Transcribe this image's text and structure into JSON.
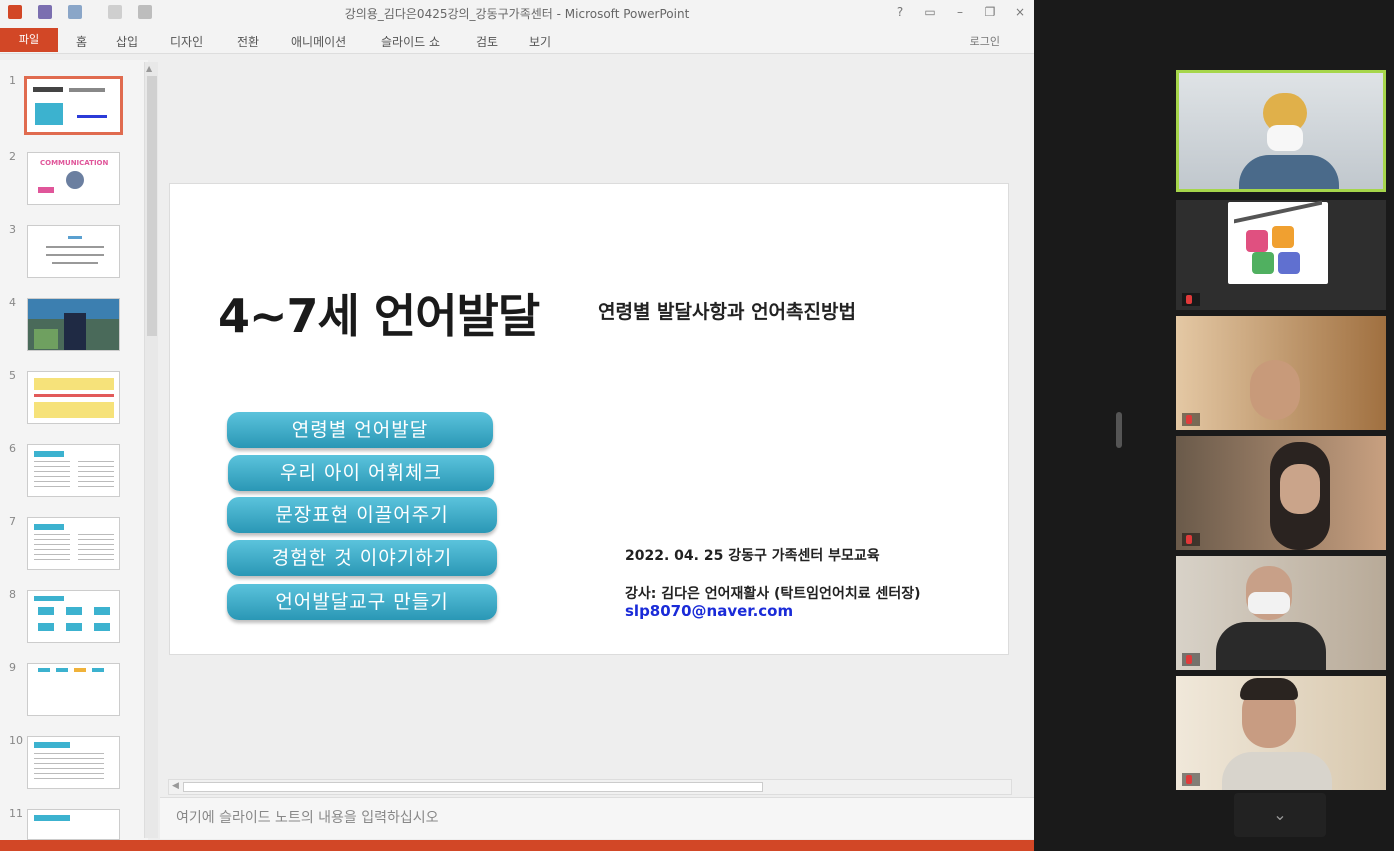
{
  "window": {
    "title": "강의용_김다은0425강의_강동구가족센터 - Microsoft PowerPoint",
    "help": "?",
    "minimize": "–",
    "close": "×"
  },
  "ribbon": {
    "file_tab": "파일",
    "tabs": [
      "홈",
      "삽입",
      "디자인",
      "전환",
      "애니메이션",
      "슬라이드 쇼",
      "검토",
      "보기"
    ],
    "login": "로그인"
  },
  "thumbnails": {
    "numbers": [
      "1",
      "2",
      "3",
      "4",
      "5",
      "6",
      "7",
      "8",
      "9",
      "10",
      "11"
    ],
    "slide2_title": "COMMUNICATION"
  },
  "slide": {
    "title": "4~7세 언어발달",
    "subtitle": "연령별 발달사항과 언어촉진방법",
    "menu": [
      "연령별 언어발달",
      "우리 아이 어휘체크",
      "문장표현 이끌어주기",
      "경험한 것 이야기하기",
      "언어발달교구 만들기"
    ],
    "date_line": "2022. 04. 25 강동구 가족센터 부모교육",
    "lecturer": "강사: 김다은 언어재활사 (탁트임언어치료 센터장)",
    "email": "slp8070@naver.com",
    "colors": {
      "pill": "#2a97b5",
      "email": "#1a2bd8"
    }
  },
  "notes": {
    "placeholder": "여기에 슬라이드 노트의 내용을 입력하십시오"
  },
  "icons": {
    "save": "save-icon",
    "undo": "undo-icon",
    "mic_muted": "mic-muted-icon",
    "chevron": "chevron-down-icon"
  },
  "zoom": {
    "more_label": "⌄",
    "active_color": "#a6d64b"
  }
}
